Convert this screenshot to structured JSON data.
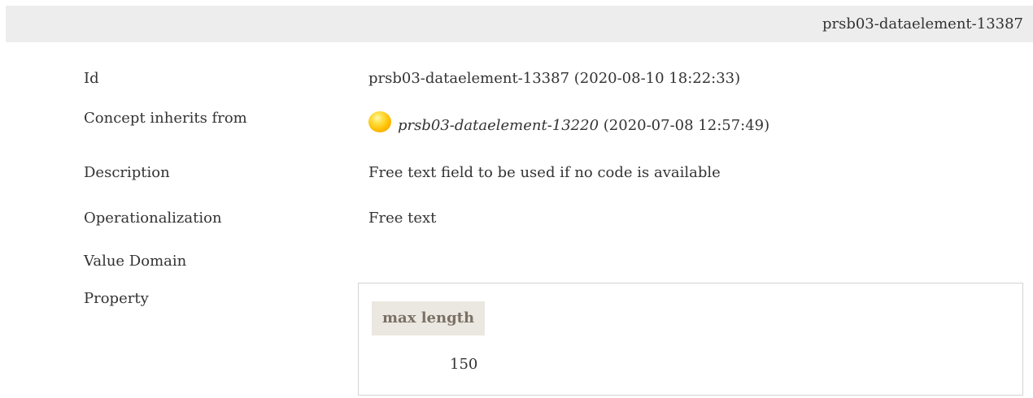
{
  "header": {
    "title": "prsb03-dataelement-13387"
  },
  "rows": {
    "id": {
      "label": "Id",
      "value": "prsb03-dataelement-13387 (2020-08-10 18:22:33)"
    },
    "inherits": {
      "label": "Concept inherits from",
      "link": "prsb03-dataelement-13220",
      "suffix": " (2020-07-08 12:57:49)",
      "icon": "status-orb-icon",
      "icon_color": "#ffbf00"
    },
    "description": {
      "label": "Description",
      "value": "Free text field to be used if no code is available"
    },
    "operationalization": {
      "label": "Operationalization",
      "value": "Free text"
    },
    "value_domain": {
      "label": "Value Domain"
    },
    "property": {
      "label": "Property",
      "header": "max length",
      "value": "150"
    }
  },
  "colors": {
    "header_bar": "#ededed",
    "property_header_bg": "#ebe7e1",
    "property_header_text": "#7a7065",
    "text": "#333333"
  }
}
